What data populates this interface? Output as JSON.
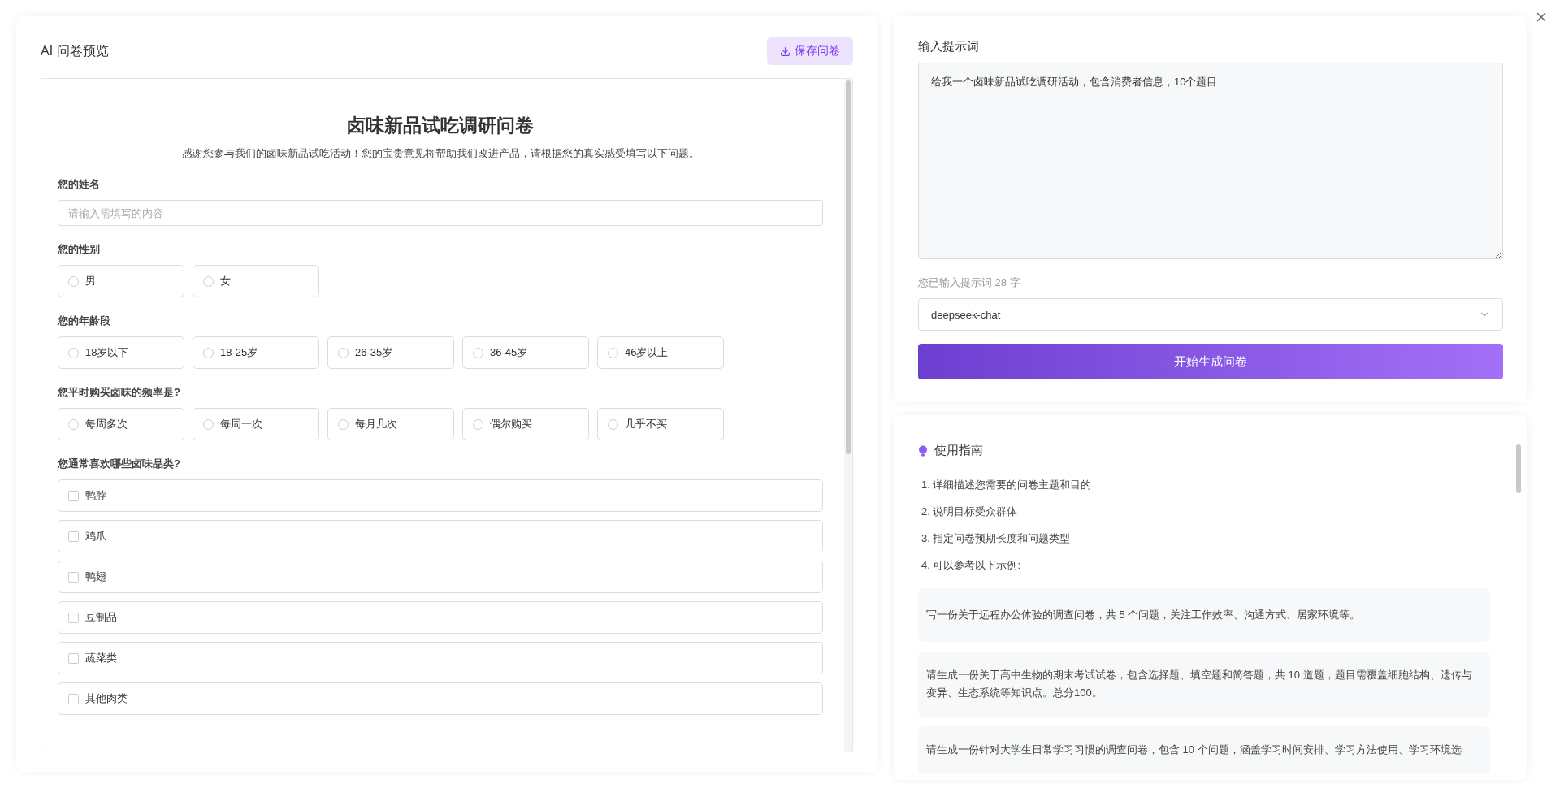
{
  "preview": {
    "title": "AI 问卷预览",
    "save_button": "保存问卷",
    "survey": {
      "title": "卤味新品试吃调研问卷",
      "description": "感谢您参与我们的卤味新品试吃活动！您的宝贵意见将帮助我们改进产品，请根据您的真实感受填写以下问题。",
      "questions": [
        {
          "kind": "text",
          "label": "您的姓名",
          "placeholder": "请输入需填写的内容"
        },
        {
          "kind": "radio",
          "label": "您的性别",
          "options": [
            {
              "label": "男",
              "selected": false
            },
            {
              "label": "女",
              "selected": false
            }
          ]
        },
        {
          "kind": "radio",
          "label": "您的年龄段",
          "options": [
            {
              "label": "18岁以下",
              "selected": false
            },
            {
              "label": "18-25岁",
              "selected": false
            },
            {
              "label": "26-35岁",
              "selected": false
            },
            {
              "label": "36-45岁",
              "selected": false
            },
            {
              "label": "46岁以上",
              "selected": false
            }
          ]
        },
        {
          "kind": "radio",
          "label": "您平时购买卤味的频率是?",
          "options": [
            {
              "label": "每周多次",
              "selected": false
            },
            {
              "label": "每周一次",
              "selected": false
            },
            {
              "label": "每月几次",
              "selected": false
            },
            {
              "label": "偶尔购买",
              "selected": false
            },
            {
              "label": "几乎不买",
              "selected": false
            }
          ]
        },
        {
          "kind": "checkbox",
          "label": "您通常喜欢哪些卤味品类?",
          "options": [
            {
              "label": "鸭脖",
              "checked": false
            },
            {
              "label": "鸡爪",
              "checked": false
            },
            {
              "label": "鸭翅",
              "checked": false
            },
            {
              "label": "豆制品",
              "checked": false
            },
            {
              "label": "蔬菜类",
              "checked": false
            },
            {
              "label": "其他肉类",
              "checked": false
            }
          ]
        }
      ]
    }
  },
  "prompt": {
    "label": "输入提示词",
    "value": "给我一个卤味新品试吃调研活动，包含消费者信息，10个题目",
    "count": "您已输入提示词 28 字",
    "model": "deepseek-chat",
    "generate_button": "开始生成问卷"
  },
  "guide": {
    "title": "使用指南",
    "steps": [
      "1. 详细描述您需要的问卷主题和目的",
      "2. 说明目标受众群体",
      "3. 指定问卷预期长度和问题类型",
      "4. 可以参考以下示例:"
    ],
    "examples": [
      "写一份关于远程办公体验的调查问卷，共 5 个问题，关注工作效率、沟通方式、居家环境等。",
      "请生成一份关于高中生物的期末考试试卷，包含选择题、填空题和简答题，共 10 道题，题目需覆盖细胞结构、遗传与变异、生态系统等知识点。总分100。",
      "请生成一份针对大学生日常学习习惯的调查问卷，包含 10 个问题，涵盖学习时间安排、学习方法使用、学习环境选"
    ]
  }
}
